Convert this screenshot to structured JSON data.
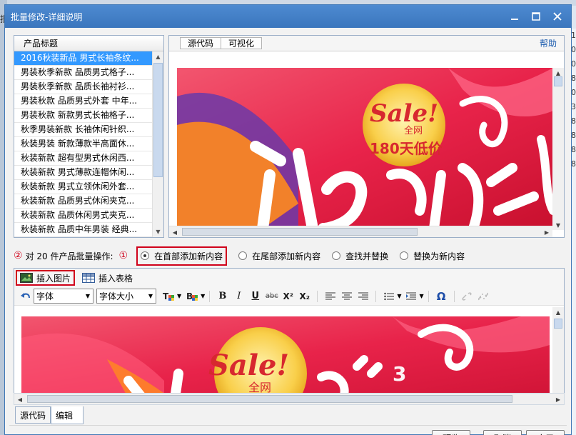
{
  "background": {
    "left_text": "批",
    "right_numbers": [
      "1",
      "0",
      "0",
      "8",
      "0",
      "3",
      "8",
      "8",
      "8",
      "8"
    ]
  },
  "dialog": {
    "title": "批量修改-详细说明",
    "controls": {
      "minimize": "—",
      "maximize": "□",
      "close": "✕"
    }
  },
  "product_list": {
    "header": "产品标题",
    "items": [
      "2016秋装新品 男式长袖条纹...",
      "男装秋季新款 品质男式格子...",
      "男装秋季新款 品质长袖衬衫...",
      "男装秋款 品质男式外套 中年...",
      "男装秋款 新款男式长袖格子...",
      "秋季男装新款 长袖休闲针织...",
      "秋装男装 新款薄款半高面休...",
      "秋装新款 超有型男式休闲西...",
      "秋装新款 男式薄款连帽休闲...",
      "秋装新款 男式立领休闲外套...",
      "秋装新款 品质男式休闲夹克...",
      "秋装新款 品质休闲男式夹克...",
      "秋装新款 品质中年男装 经典..."
    ],
    "selected_index": 0
  },
  "preview": {
    "tabs": [
      "源代码",
      "可视化"
    ],
    "help": "帮助",
    "banner": {
      "sale": "Sale!",
      "quanwang": "全网",
      "days": "180天低价"
    }
  },
  "operations": {
    "prefix": "对 20 件产品批量操作:",
    "marker1": "①",
    "marker2": "②",
    "options": [
      "在首部添加新内容",
      "在尾部添加新内容",
      "查找并替换",
      "替换为新内容"
    ],
    "selected_index": 0
  },
  "editor": {
    "insert_image": "插入图片",
    "insert_table": "插入表格",
    "font_select": "字体",
    "font_size_select": "字体大小",
    "format_buttons": {
      "bold": "B",
      "italic": "I",
      "underline": "U",
      "strike": "abc",
      "superscript": "X²",
      "subscript": "X₂",
      "omega": "Ω"
    },
    "banner": {
      "sale": "Sale!",
      "quanwang": "全网"
    },
    "tabs": [
      "源代码",
      "编辑"
    ]
  },
  "footer": {
    "preview": "预览",
    "cancel": "取消",
    "apply": "应用"
  },
  "colors": {
    "titlebar": "#3b76bd",
    "selection": "#3399ff",
    "highlight": "#d0021b",
    "banner_red": "#e8234a"
  }
}
